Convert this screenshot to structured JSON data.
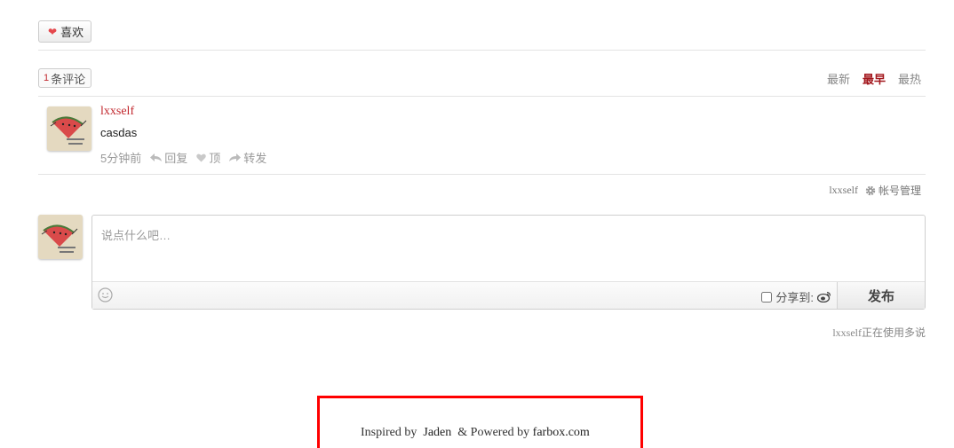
{
  "like_button": {
    "label": "喜欢",
    "icon": "heart-icon",
    "icon_color": "#e5484d"
  },
  "comments_header": {
    "count": "1",
    "count_label": "条评论",
    "sort_tabs": [
      {
        "label": "最新",
        "active": false
      },
      {
        "label": "最早",
        "active": true
      },
      {
        "label": "最热",
        "active": false
      }
    ]
  },
  "comments": [
    {
      "author": "lxxself",
      "text": "casdas",
      "time": "5分钟前",
      "actions": {
        "reply": "回复",
        "upvote": "顶",
        "forward": "转发"
      }
    }
  ],
  "account": {
    "username": "lxxself",
    "manage_label": "帐号管理"
  },
  "editor": {
    "placeholder": "说点什么吧…",
    "share_label": "分享到:",
    "publish_label": "发布"
  },
  "using_note": {
    "username": "lxxself",
    "suffix": "正在使用多说"
  },
  "footer": {
    "inspired_prefix": "Inspired by",
    "inspired_name": "Jaden",
    "powered_prefix": "& Powered by",
    "powered_name": "farbox.com"
  },
  "colors": {
    "accent": "#c1272d",
    "highlight_box": "#ff0000"
  }
}
